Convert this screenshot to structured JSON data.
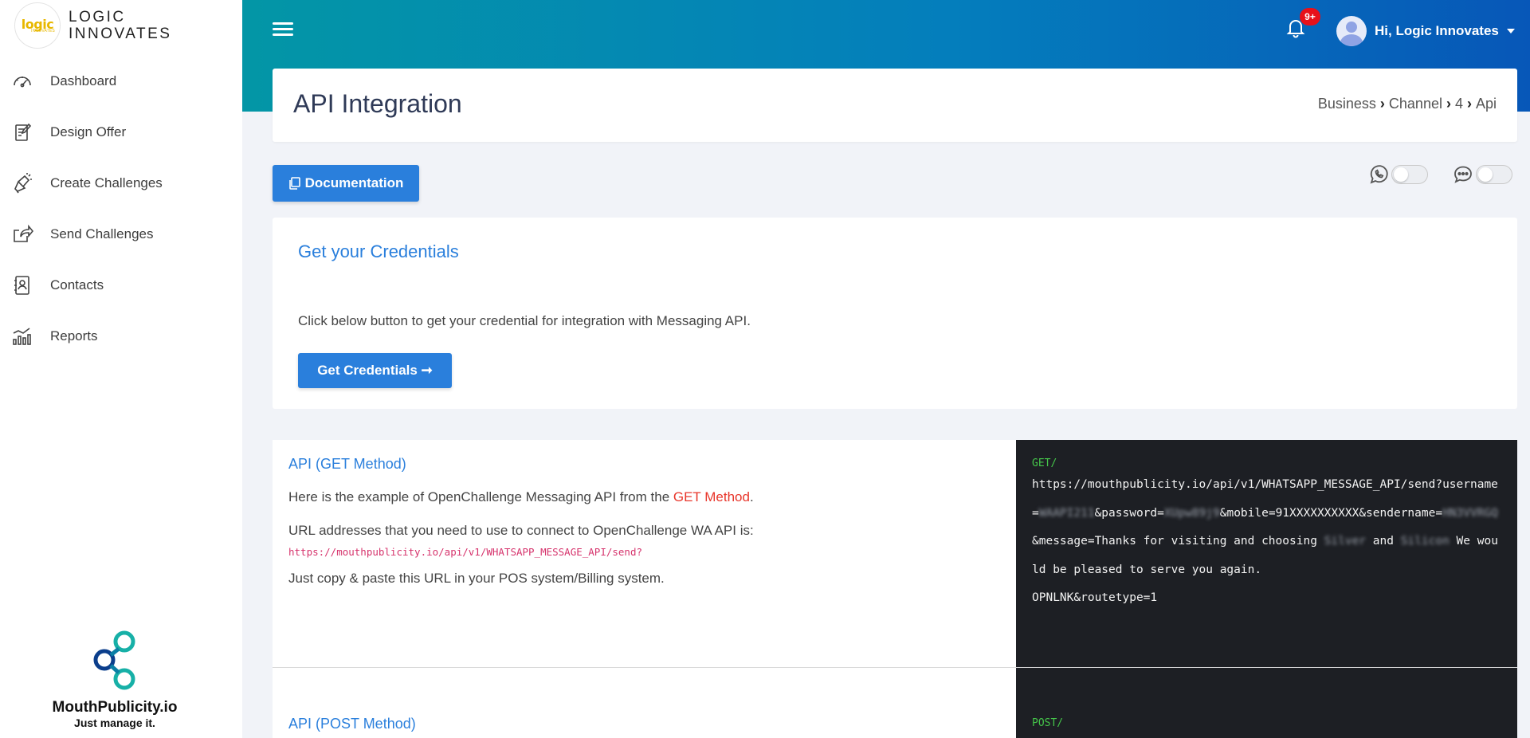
{
  "brand": {
    "logo_top": "logic",
    "logo_bottom": "INNOVATES",
    "name_line1": "LOGIC",
    "name_line2": "INNOVATES"
  },
  "sidebar": {
    "items": [
      {
        "label": "Dashboard",
        "icon": "speedometer-icon"
      },
      {
        "label": "Design Offer",
        "icon": "design-doc-icon"
      },
      {
        "label": "Create Challenges",
        "icon": "megaphone-icon"
      },
      {
        "label": "Send Challenges",
        "icon": "share-icon"
      },
      {
        "label": "Contacts",
        "icon": "contact-book-icon"
      },
      {
        "label": "Reports",
        "icon": "bar-chart-icon"
      }
    ],
    "footer": {
      "title": "MouthPublicity.io",
      "tagline": "Just manage it."
    }
  },
  "header": {
    "notification_count": "9+",
    "user_greeting": "Hi, Logic Innovates",
    "gradient": [
      "#0396a6",
      "#047ebc",
      "#0757b8"
    ]
  },
  "page": {
    "title": "API Integration",
    "breadcrumb": [
      "Business",
      "Channel",
      "4",
      "Api"
    ]
  },
  "toolbar": {
    "documentation_label": "Documentation",
    "toggles": [
      {
        "icon": "whatsapp-icon",
        "on": false
      },
      {
        "icon": "message-icon",
        "on": false
      }
    ]
  },
  "credentials": {
    "title": "Get your Credentials",
    "description": "Click below button to get your credential for integration with Messaging API.",
    "button_label": "Get Credentials ➞"
  },
  "api_get": {
    "heading": "API (GET Method)",
    "intro_before": "Here is the example of OpenChallenge Messaging API from the ",
    "intro_highlight": "GET Method",
    "intro_after": ".",
    "url_label": "URL addresses that you need to use to connect to OpenChallenge WA API is:",
    "url": "https://mouthpublicity.io/api/v1/WHATSAPP_MESSAGE_API/send?",
    "copy_note": "Just copy & paste this URL in your POS system/Billing system.",
    "code_method": "GET/",
    "code": {
      "base_url": "https://mouthpublicity.io/api/v1/WHATSAPP_MESSAGE_API/send?",
      "username_key": "username=",
      "username_val": "WAAPI211",
      "password_key": "&password=",
      "password_val": "XUpw89j9",
      "mobile": "&mobile=91XXXXXXXXXX&sendername=",
      "sender_val": "HN3VVRGQ",
      "message_key": "&message=Thanks for visiting and choosing ",
      "business_1": "Silver",
      "and": " and ",
      "business_2": "Silicon",
      "message_tail": " We would be pleased to serve you again.",
      "route": "OPNLNK&routetype=1"
    }
  },
  "api_post": {
    "heading": "API (POST Method)",
    "code_method": "POST/"
  },
  "colors": {
    "primary": "#2a7fdc",
    "highlight": "#e8362b",
    "code_bg": "#1d1f24",
    "code_method": "#45c54a"
  }
}
